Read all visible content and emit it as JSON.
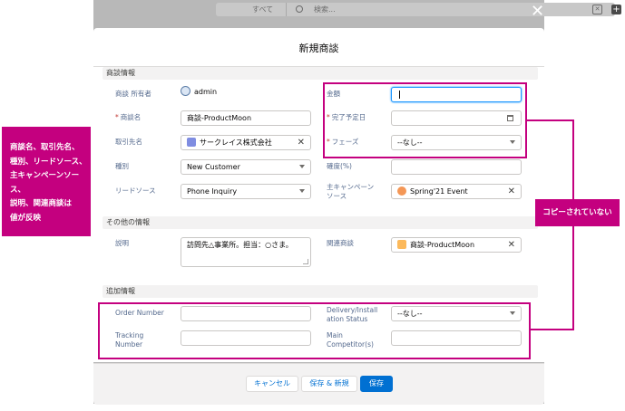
{
  "background": {
    "search_scope": "すべて",
    "search_placeholder": "検索..."
  },
  "modal": {
    "title": "新規商談",
    "sections": {
      "info": "商談情報",
      "other": "その他の情報",
      "extra": "追加情報"
    },
    "fields": {
      "owner_label": "商談 所有者",
      "owner_value": "admin",
      "amount_label": "金額",
      "name_label": "商談名",
      "name_value": "商談-ProductMoon",
      "close_date_label": "完了予定日",
      "account_label": "取引先名",
      "account_value": "サークレイス株式会社",
      "stage_label": "フェーズ",
      "stage_value": "--なし--",
      "type_label": "種別",
      "type_value": "New Customer",
      "probability_label": "確度(%)",
      "lead_source_label": "リードソース",
      "lead_source_value": "Phone Inquiry",
      "campaign_label_1": "主キャンペーン",
      "campaign_label_2": "ソース",
      "campaign_value": "Spring'21 Event",
      "description_label": "説明",
      "description_value": "訪問先△事業所。担当：○さま。",
      "related_label": "関連商談",
      "related_value": "商談-ProductMoon",
      "order_number_label": "Order Number",
      "delivery_label_1": "Delivery/Install",
      "delivery_label_2": "ation Status",
      "delivery_value": "--なし--",
      "tracking_label_1": "Tracking",
      "tracking_label_2": "Number",
      "competitor_label_1": "Main",
      "competitor_label_2": "Competitor(s)",
      "required_mark": "*"
    },
    "buttons": {
      "cancel": "キャンセル",
      "save_new": "保存 & 新規",
      "save": "保存"
    }
  },
  "annotations": {
    "left_note": [
      "商談名、取引先名、",
      "種別、リードソース、",
      "主キャンペーンソース、",
      "説明、関連商談は",
      "値が反映"
    ],
    "right_note": "コピーされていない"
  },
  "colors": {
    "highlight": "#c4007f",
    "brand": "#0070d2",
    "account_icon": "#7f8de1",
    "campaign_icon": "#f49756",
    "related_icon": "#fcb95b"
  }
}
